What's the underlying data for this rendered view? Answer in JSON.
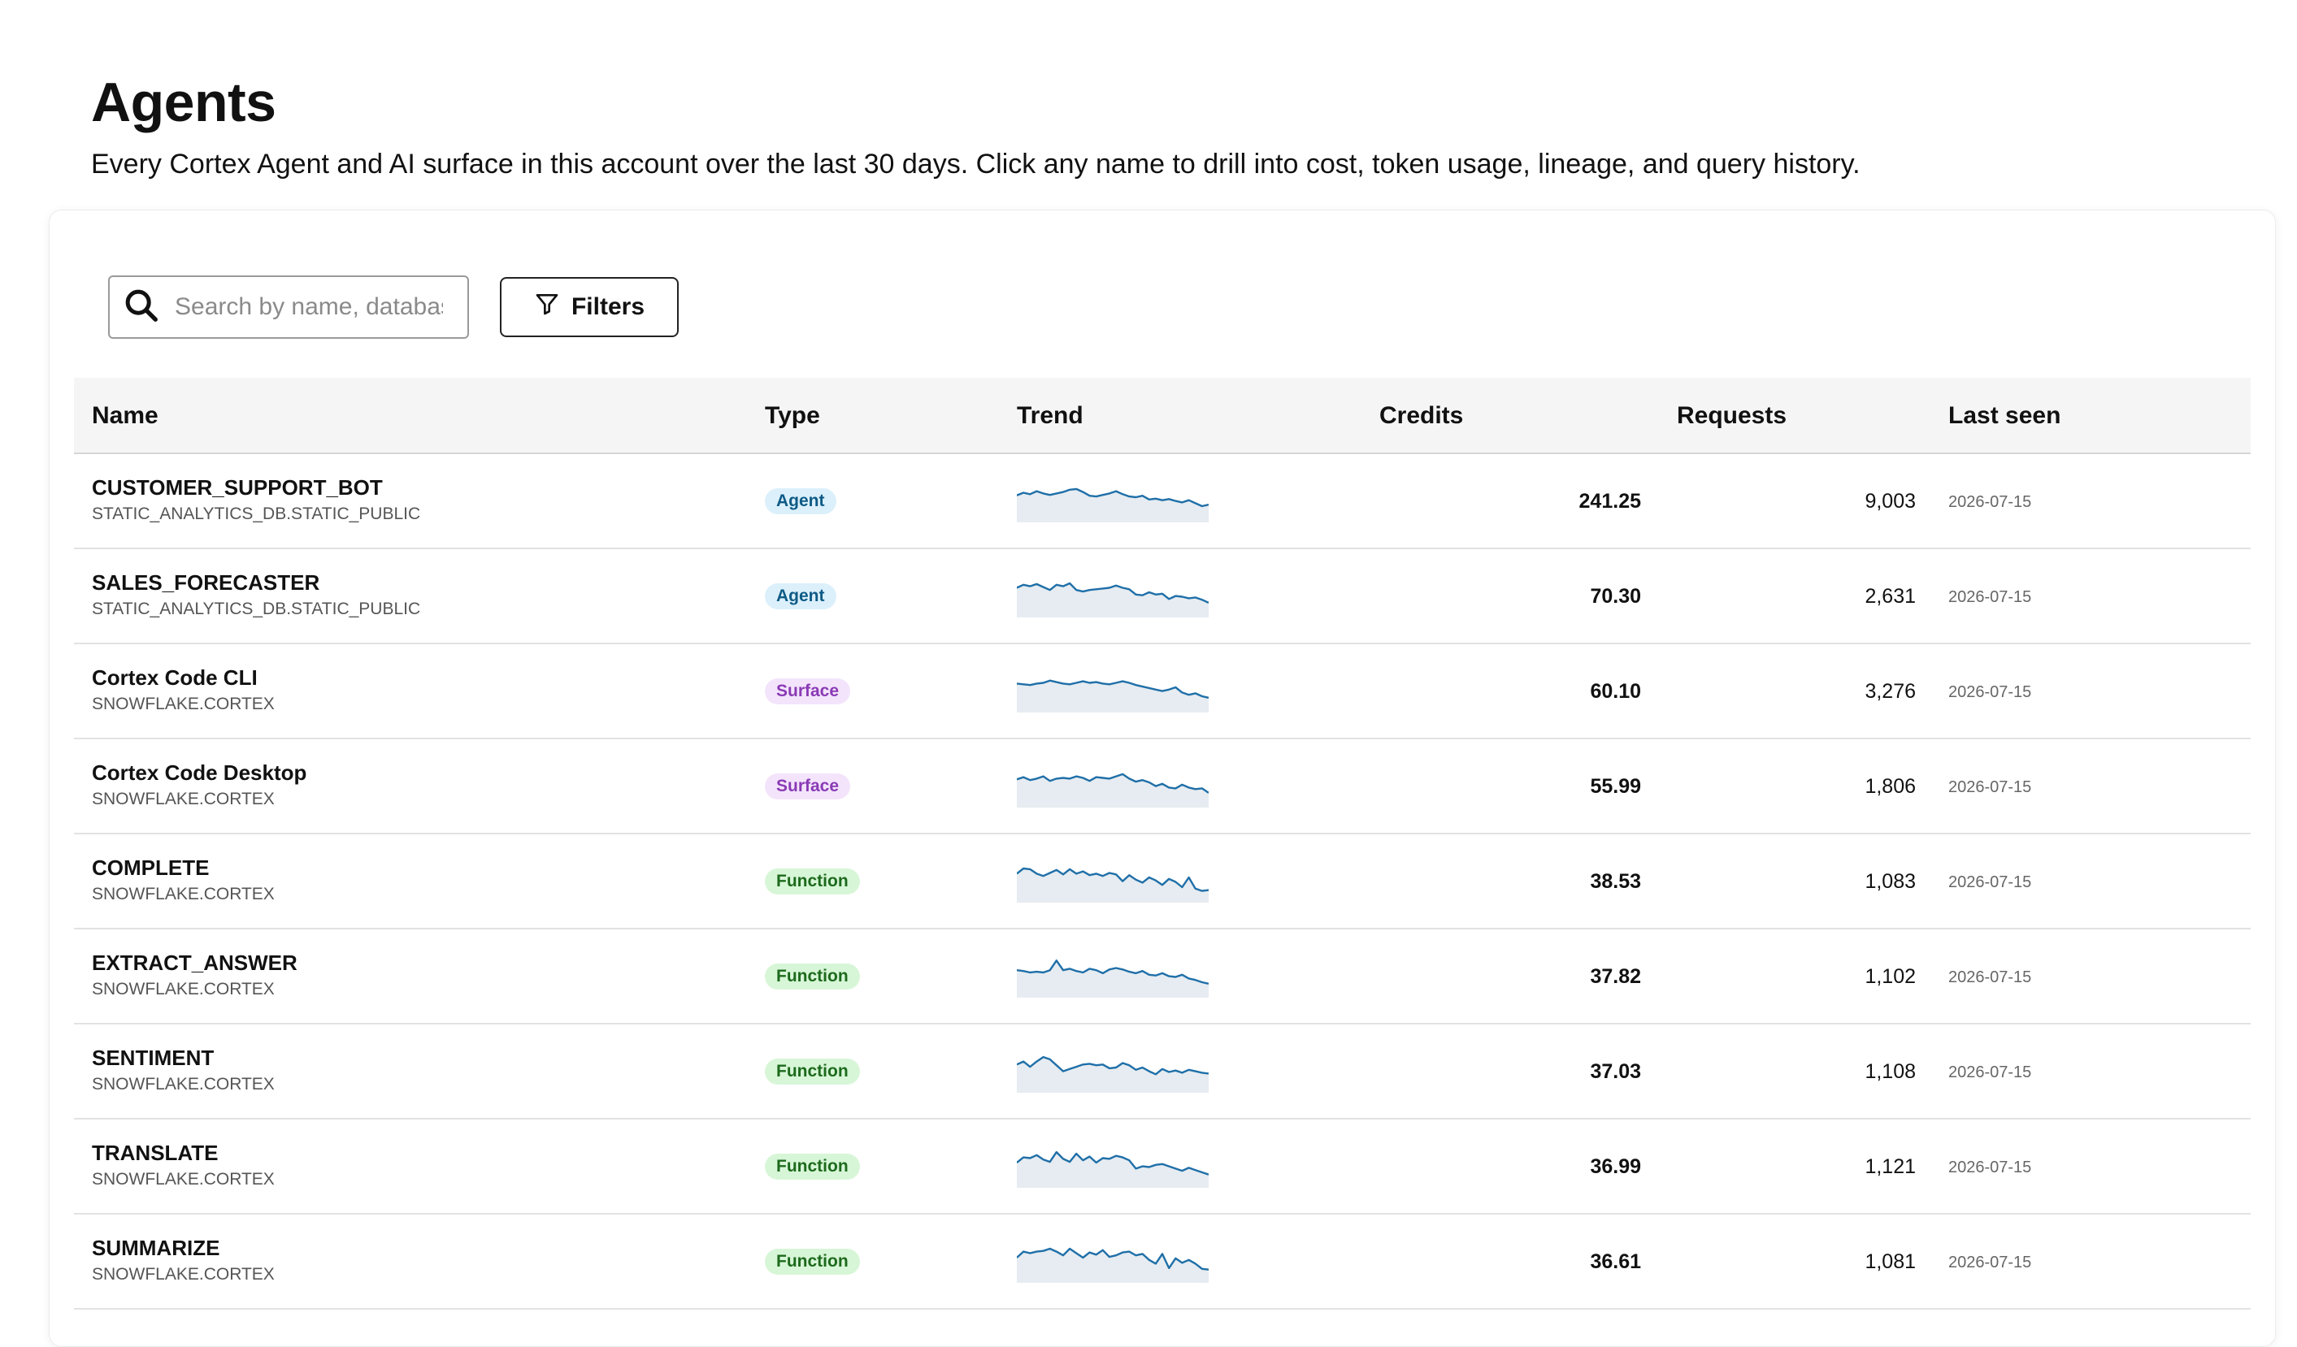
{
  "page": {
    "title": "Agents",
    "subtitle": "Every Cortex Agent and AI surface in this account over the last 30 days. Click any name to drill into cost, token usage, lineage, and query history."
  },
  "toolbar": {
    "search_placeholder": "Search by name, database, schema...",
    "filters_label": "Filters"
  },
  "table": {
    "columns": {
      "name": "Name",
      "type": "Type",
      "trend": "Trend",
      "credits": "Credits",
      "requests": "Requests",
      "last_seen": "Last seen"
    },
    "rows": [
      {
        "name": "CUSTOMER_SUPPORT_BOT",
        "location": "STATIC_ANALYTICS_DB.STATIC_PUBLIC",
        "type": "Agent",
        "type_key": "agent",
        "credits": "241.25",
        "requests": "9,003",
        "last_seen": "2026-07-15",
        "trend": [
          0.55,
          0.62,
          0.58,
          0.66,
          0.6,
          0.56,
          0.6,
          0.64,
          0.7,
          0.72,
          0.64,
          0.54,
          0.52,
          0.56,
          0.6,
          0.66,
          0.58,
          0.52,
          0.5,
          0.54,
          0.44,
          0.46,
          0.42,
          0.45,
          0.4,
          0.36,
          0.42,
          0.34,
          0.26,
          0.3
        ]
      },
      {
        "name": "SALES_FORECASTER",
        "location": "STATIC_ANALYTICS_DB.STATIC_PUBLIC",
        "type": "Agent",
        "type_key": "agent",
        "credits": "70.30",
        "requests": "2,631",
        "last_seen": "2026-07-15",
        "trend": [
          0.62,
          0.7,
          0.66,
          0.72,
          0.64,
          0.56,
          0.7,
          0.66,
          0.74,
          0.56,
          0.52,
          0.56,
          0.58,
          0.6,
          0.62,
          0.68,
          0.62,
          0.58,
          0.44,
          0.42,
          0.5,
          0.44,
          0.46,
          0.32,
          0.4,
          0.38,
          0.34,
          0.36,
          0.3,
          0.22
        ]
      },
      {
        "name": "Cortex Code CLI",
        "location": "SNOWFLAKE.CORTEX",
        "type": "Surface",
        "type_key": "surface",
        "credits": "60.10",
        "requests": "3,276",
        "last_seen": "2026-07-15",
        "trend": [
          0.6,
          0.58,
          0.56,
          0.6,
          0.62,
          0.68,
          0.64,
          0.6,
          0.58,
          0.62,
          0.66,
          0.62,
          0.64,
          0.6,
          0.58,
          0.62,
          0.66,
          0.62,
          0.56,
          0.52,
          0.48,
          0.44,
          0.4,
          0.44,
          0.5,
          0.36,
          0.3,
          0.34,
          0.26,
          0.22
        ]
      },
      {
        "name": "Cortex Code Desktop",
        "location": "SNOWFLAKE.CORTEX",
        "type": "Surface",
        "type_key": "surface",
        "credits": "55.99",
        "requests": "1,806",
        "last_seen": "2026-07-15",
        "trend": [
          0.58,
          0.64,
          0.56,
          0.6,
          0.66,
          0.54,
          0.6,
          0.62,
          0.6,
          0.66,
          0.62,
          0.54,
          0.64,
          0.62,
          0.6,
          0.66,
          0.72,
          0.6,
          0.52,
          0.56,
          0.5,
          0.4,
          0.46,
          0.36,
          0.34,
          0.44,
          0.36,
          0.32,
          0.34,
          0.22
        ]
      },
      {
        "name": "COMPLETE",
        "location": "SNOWFLAKE.CORTEX",
        "type": "Function",
        "type_key": "function",
        "credits": "38.53",
        "requests": "1,083",
        "last_seen": "2026-07-15",
        "trend": [
          0.6,
          0.74,
          0.72,
          0.6,
          0.54,
          0.62,
          0.7,
          0.58,
          0.72,
          0.6,
          0.66,
          0.56,
          0.6,
          0.54,
          0.62,
          0.58,
          0.4,
          0.56,
          0.44,
          0.36,
          0.5,
          0.42,
          0.3,
          0.46,
          0.38,
          0.24,
          0.5,
          0.2,
          0.14,
          0.16
        ]
      },
      {
        "name": "EXTRACT_ANSWER",
        "location": "SNOWFLAKE.CORTEX",
        "type": "Function",
        "type_key": "function",
        "credits": "37.82",
        "requests": "1,102",
        "last_seen": "2026-07-15",
        "trend": [
          0.56,
          0.54,
          0.5,
          0.52,
          0.5,
          0.56,
          0.82,
          0.56,
          0.6,
          0.54,
          0.5,
          0.6,
          0.56,
          0.48,
          0.58,
          0.62,
          0.58,
          0.52,
          0.48,
          0.54,
          0.44,
          0.42,
          0.48,
          0.4,
          0.38,
          0.44,
          0.34,
          0.3,
          0.24,
          0.2
        ]
      },
      {
        "name": "SENTIMENT",
        "location": "SNOWFLAKE.CORTEX",
        "type": "Function",
        "type_key": "function",
        "credits": "37.03",
        "requests": "1,108",
        "last_seen": "2026-07-15",
        "trend": [
          0.58,
          0.66,
          0.52,
          0.66,
          0.78,
          0.72,
          0.56,
          0.4,
          0.46,
          0.52,
          0.58,
          0.6,
          0.56,
          0.58,
          0.48,
          0.5,
          0.62,
          0.56,
          0.44,
          0.5,
          0.4,
          0.32,
          0.46,
          0.38,
          0.42,
          0.36,
          0.44,
          0.4,
          0.36,
          0.34
        ]
      },
      {
        "name": "TRANSLATE",
        "location": "SNOWFLAKE.CORTEX",
        "type": "Function",
        "type_key": "function",
        "credits": "36.99",
        "requests": "1,121",
        "last_seen": "2026-07-15",
        "trend": [
          0.5,
          0.64,
          0.62,
          0.7,
          0.58,
          0.52,
          0.78,
          0.6,
          0.52,
          0.74,
          0.56,
          0.66,
          0.5,
          0.62,
          0.6,
          0.68,
          0.64,
          0.56,
          0.34,
          0.4,
          0.38,
          0.44,
          0.46,
          0.4,
          0.34,
          0.28,
          0.36,
          0.3,
          0.24,
          0.18
        ]
      },
      {
        "name": "SUMMARIZE",
        "location": "SNOWFLAKE.CORTEX",
        "type": "Function",
        "type_key": "function",
        "credits": "36.61",
        "requests": "1,081",
        "last_seen": "2026-07-15",
        "trend": [
          0.5,
          0.66,
          0.62,
          0.66,
          0.68,
          0.74,
          0.66,
          0.56,
          0.74,
          0.62,
          0.5,
          0.64,
          0.58,
          0.7,
          0.52,
          0.56,
          0.64,
          0.66,
          0.56,
          0.6,
          0.44,
          0.34,
          0.6,
          0.22,
          0.48,
          0.36,
          0.44,
          0.34,
          0.2,
          0.18
        ]
      }
    ]
  },
  "colors": {
    "spark_line": "#1f6fa8",
    "spark_fill": "#e6ecf1"
  }
}
